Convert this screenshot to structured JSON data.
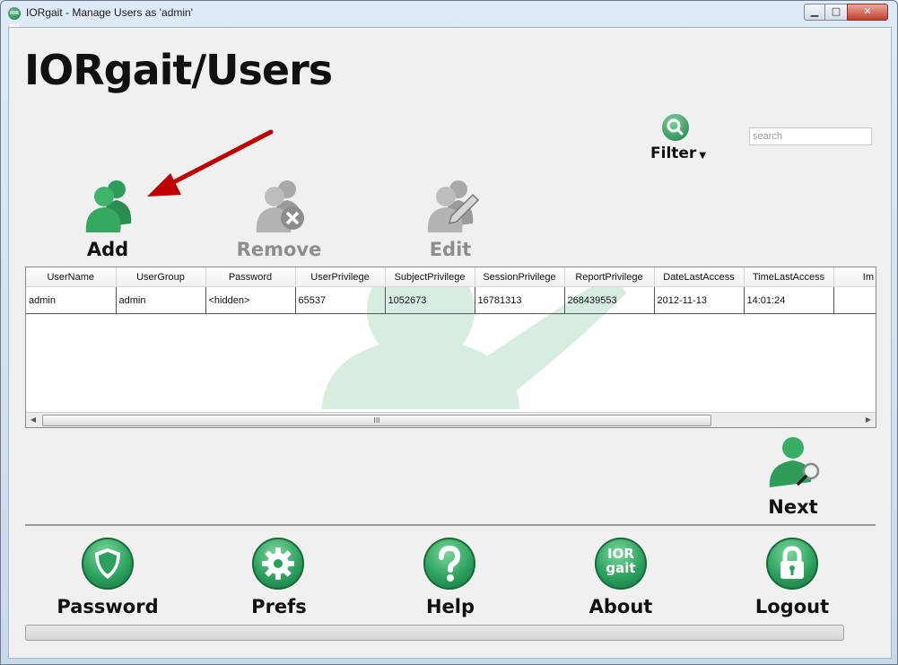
{
  "window": {
    "title": "IORgait - Manage Users as 'admin'",
    "icon_text": "IOR gait",
    "controls": {
      "minimize": "▁",
      "maximize": "□",
      "close": "✕"
    }
  },
  "page": {
    "title": "IORgait/Users"
  },
  "toolbar": {
    "add": {
      "label": "Add",
      "enabled": true
    },
    "remove": {
      "label": "Remove",
      "enabled": false
    },
    "edit": {
      "label": "Edit",
      "enabled": false
    },
    "filter": {
      "label": "Filter",
      "caret": "▼"
    }
  },
  "search": {
    "placeholder": "search",
    "value": ""
  },
  "table": {
    "columns": [
      "UserName",
      "UserGroup",
      "Password",
      "UserPrivilege",
      "SubjectPrivilege",
      "SessionPrivilege",
      "ReportPrivilege",
      "DateLastAccess",
      "TimeLastAccess",
      "Im"
    ],
    "rows": [
      [
        "admin",
        "admin",
        "<hidden>",
        "65537",
        "1052673",
        "16781313",
        "268439553",
        "2012-11-13",
        "14:01:24",
        ""
      ]
    ],
    "scroll": {
      "left": "◀",
      "grip": "III",
      "right": "▶"
    }
  },
  "next": {
    "label": "Next"
  },
  "bottom_nav": [
    {
      "label": "Password",
      "icon": "shield-icon"
    },
    {
      "label": "Prefs",
      "icon": "gear-icon"
    },
    {
      "label": "Help",
      "icon": "question-icon"
    },
    {
      "label": "About",
      "icon": "ior-gait-logo-icon",
      "icon_text_1": "IOR",
      "icon_text_2": "gait"
    },
    {
      "label": "Logout",
      "icon": "lock-icon"
    }
  ],
  "colors": {
    "brand_green": "#2aa05c",
    "arrow_red": "#c00000",
    "disabled_gray": "#8e8e8e"
  }
}
